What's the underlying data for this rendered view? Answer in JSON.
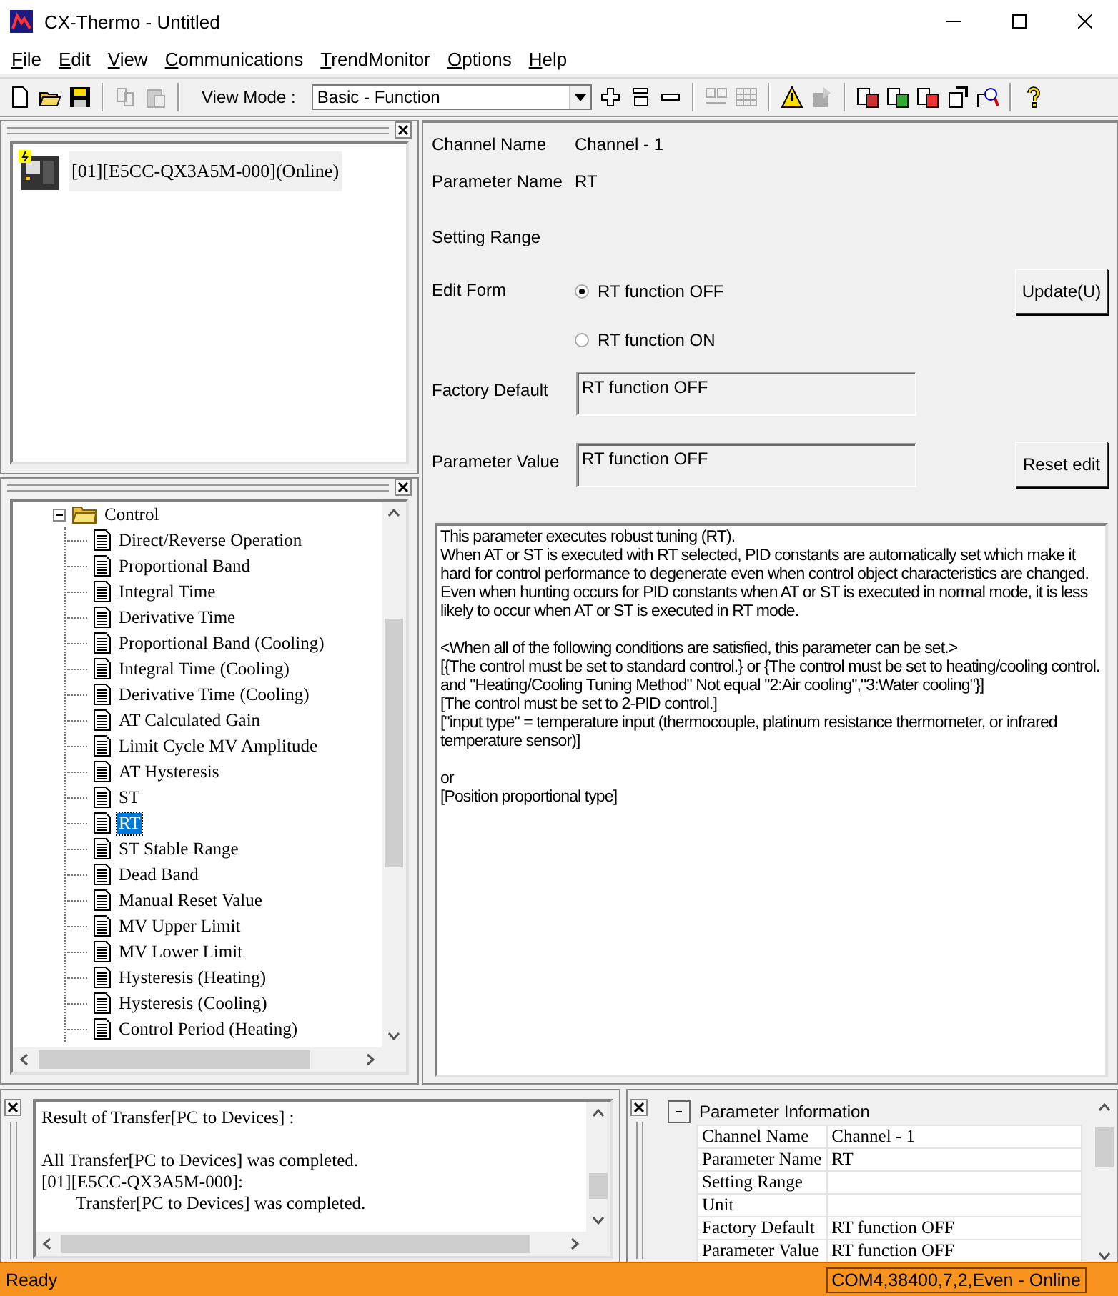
{
  "window": {
    "title": "CX-Thermo - Untitled"
  },
  "menu": [
    "File",
    "Edit",
    "View",
    "Communications",
    "TrendMonitor",
    "Options",
    "Help"
  ],
  "toolbar": {
    "view_mode_label": "View Mode :",
    "view_mode_value": "Basic - Function"
  },
  "device_pane": {
    "device": "[01][E5CC-QX3A5M-000](Online)"
  },
  "tree": {
    "label": "Control",
    "expanded": true,
    "children": [
      {
        "label": "Direct/Reverse Operation",
        "selected": false
      },
      {
        "label": "Proportional Band",
        "selected": false
      },
      {
        "label": "Integral Time",
        "selected": false
      },
      {
        "label": "Derivative Time",
        "selected": false
      },
      {
        "label": "Proportional Band (Cooling)",
        "selected": false
      },
      {
        "label": "Integral Time (Cooling)",
        "selected": false
      },
      {
        "label": "Derivative Time (Cooling)",
        "selected": false
      },
      {
        "label": "AT Calculated Gain",
        "selected": false
      },
      {
        "label": "Limit Cycle MV Amplitude",
        "selected": false
      },
      {
        "label": "AT Hysteresis",
        "selected": false
      },
      {
        "label": "ST",
        "selected": false
      },
      {
        "label": "RT",
        "selected": true
      },
      {
        "label": "ST Stable Range",
        "selected": false
      },
      {
        "label": "Dead Band",
        "selected": false
      },
      {
        "label": "Manual Reset Value",
        "selected": false
      },
      {
        "label": "MV Upper Limit",
        "selected": false
      },
      {
        "label": "MV Lower Limit",
        "selected": false
      },
      {
        "label": "Hysteresis (Heating)",
        "selected": false
      },
      {
        "label": "Hysteresis (Cooling)",
        "selected": false
      },
      {
        "label": "Control Period (Heating)",
        "selected": false
      }
    ]
  },
  "form": {
    "channel_name_label": "Channel Name",
    "channel_name": "Channel - 1",
    "parameter_name_label": "Parameter Name",
    "parameter_name": "RT",
    "setting_range_label": "Setting Range",
    "edit_form_label": "Edit Form",
    "options": [
      {
        "label": "RT function OFF",
        "selected": true
      },
      {
        "label": "RT function ON",
        "selected": false
      }
    ],
    "update_button": "Update(U)",
    "factory_default_label": "Factory Default",
    "factory_default": "RT function OFF",
    "parameter_value_label": "Parameter Value",
    "parameter_value": "RT function OFF",
    "reset_button": "Reset edit"
  },
  "description": [
    [
      "This parameter executes robust tuning (RT).",
      "When AT or ST is executed with RT selected, PID constants are automatically set which make it hard for control performance to degenerate even when control object characteristics are changed. Even when hunting occurs for PID constants when AT or ST is executed in normal mode, it is less likely to occur when AT or ST is executed in RT mode."
    ],
    [
      "<When all of the following conditions are satisfied, this parameter can be set.>",
      "[{The control must be set to standard control.} or {The control must be set to heating/cooling control. and \"Heating/Cooling Tuning Method\" Not equal \"2:Air cooling\",\"3:Water cooling\"}]",
      "[The control must be set to 2-PID control.]",
      "[\"input type\" = temperature input (thermocouple, platinum resistance thermometer, or infrared temperature sensor)]"
    ],
    [
      "or",
      "[Position proportional type]"
    ]
  ],
  "log": [
    [
      {
        "text": "Result of Transfer[PC to Devices] :"
      }
    ],
    [
      {
        "text": "All Transfer[PC to Devices] was completed."
      },
      {
        "text": "[01][E5CC-QX3A5M-000]:",
        "children": [
          {
            "text": "Transfer[PC to Devices] was completed."
          }
        ]
      }
    ]
  ],
  "parameter_info": {
    "title": "Parameter Information",
    "expanded": true,
    "rows": [
      {
        "name": "Channel Name",
        "value": "Channel - 1"
      },
      {
        "name": "Parameter Name",
        "value": "RT"
      },
      {
        "name": "Setting Range",
        "value": ""
      },
      {
        "name": "Unit",
        "value": ""
      },
      {
        "name": "Factory Default",
        "value": "RT function OFF"
      },
      {
        "name": "Parameter Value",
        "value": "RT function OFF"
      }
    ]
  },
  "status_bar": {
    "left": "Ready",
    "right": "COM4,38400,7,2,Even - Online"
  }
}
